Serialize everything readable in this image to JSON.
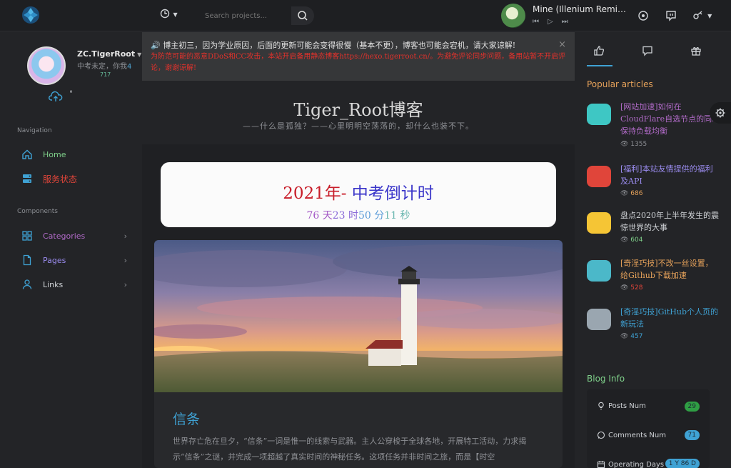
{
  "topbar": {
    "search_placeholder": "Search projects...",
    "song_title": "Mine (Illenium Remi…"
  },
  "user": {
    "name": "ZC.TigerRoot",
    "motto": "中考未定，你我",
    "motto_num": "4",
    "nums": "717",
    "dot": "°"
  },
  "nav": {
    "navigation_label": "Navigation",
    "components_label": "Components",
    "home": "Home",
    "status": "服务状态",
    "categories": "Categories",
    "pages": "Pages",
    "links": "Links",
    "colors": {
      "home": "#7fd08a",
      "status": "#e0453a",
      "categories": "#b06ac7",
      "pages": "#9b8cf0",
      "links": "#cfd2d6"
    }
  },
  "notice": {
    "line1": "🔊 博主初三，因为学业原因，后面的更新可能会变得很慢（基本不更），博客也可能会宕机，请大家谅解!",
    "line2": "为防范可能的恶意DDoS和CC攻击，本站开启备用静态博客https://hexo.tigerroot.cn/。为避免评论同步问题，备用站暂不开启评论，谢谢谅解!",
    "close": "×"
  },
  "header": {
    "title": "Tiger_Root博客",
    "subtitle": "——什么是孤独？——心里明明空荡荡的，却什么也装不下。"
  },
  "countdown": {
    "year": "2021年-",
    "label": " 中考倒计时",
    "days": "76 天",
    "hours": "23 时",
    "minutes": "50 分",
    "seconds": "11 秒"
  },
  "post": {
    "title": "信条",
    "excerpt": "世界存亡危在旦夕，“信条”一词是惟一的线索与武器。主人公穿梭于全球各地，开展特工活动，力求揭示“信条”之谜，并完成一项超越了真实时间的神秘任务。这项任务并非时间之旅，而是【时空"
  },
  "sidebar": {
    "popular_heading": "Popular articles",
    "articles": [
      {
        "title": "[网站加速]如何在CloudFlare自选节点的同时保持负载均衡",
        "views": "1355",
        "title_color": "#b06ac7",
        "views_color": "#8d8f94",
        "thumb_color": "#3ec7c4"
      },
      {
        "title": "[福利]本站友情提供的福利及API",
        "views": "686",
        "title_color": "#9b8cf0",
        "views_color": "#e6a25a",
        "thumb_color": "#e0453a"
      },
      {
        "title": "盘点2020年上半年发生的震惊世界的大事",
        "views": "604",
        "title_color": "#cfd2d6",
        "views_color": "#7fd08a",
        "thumb_color": "#f5c535"
      },
      {
        "title": "[奇淫巧技]不改一丝设置，给Github下载加速",
        "views": "528",
        "title_color": "#e6a25a",
        "views_color": "#e0453a",
        "thumb_color": "#4bb8c9"
      },
      {
        "title": "[奇淫巧技]GitHub个人页的新玩法",
        "views": "457",
        "title_color": "#3fa2d4",
        "views_color": "#3fa2d4",
        "thumb_color": "#9aa6b0"
      }
    ],
    "blog_info_heading": "Blog Info",
    "posts_num_label": "Posts Num",
    "posts_num": "29",
    "comments_num_label": "Comments Num",
    "comments_num": "71",
    "operating_days_label": "Operating Days",
    "operating_days": "1 Y 86 D"
  }
}
